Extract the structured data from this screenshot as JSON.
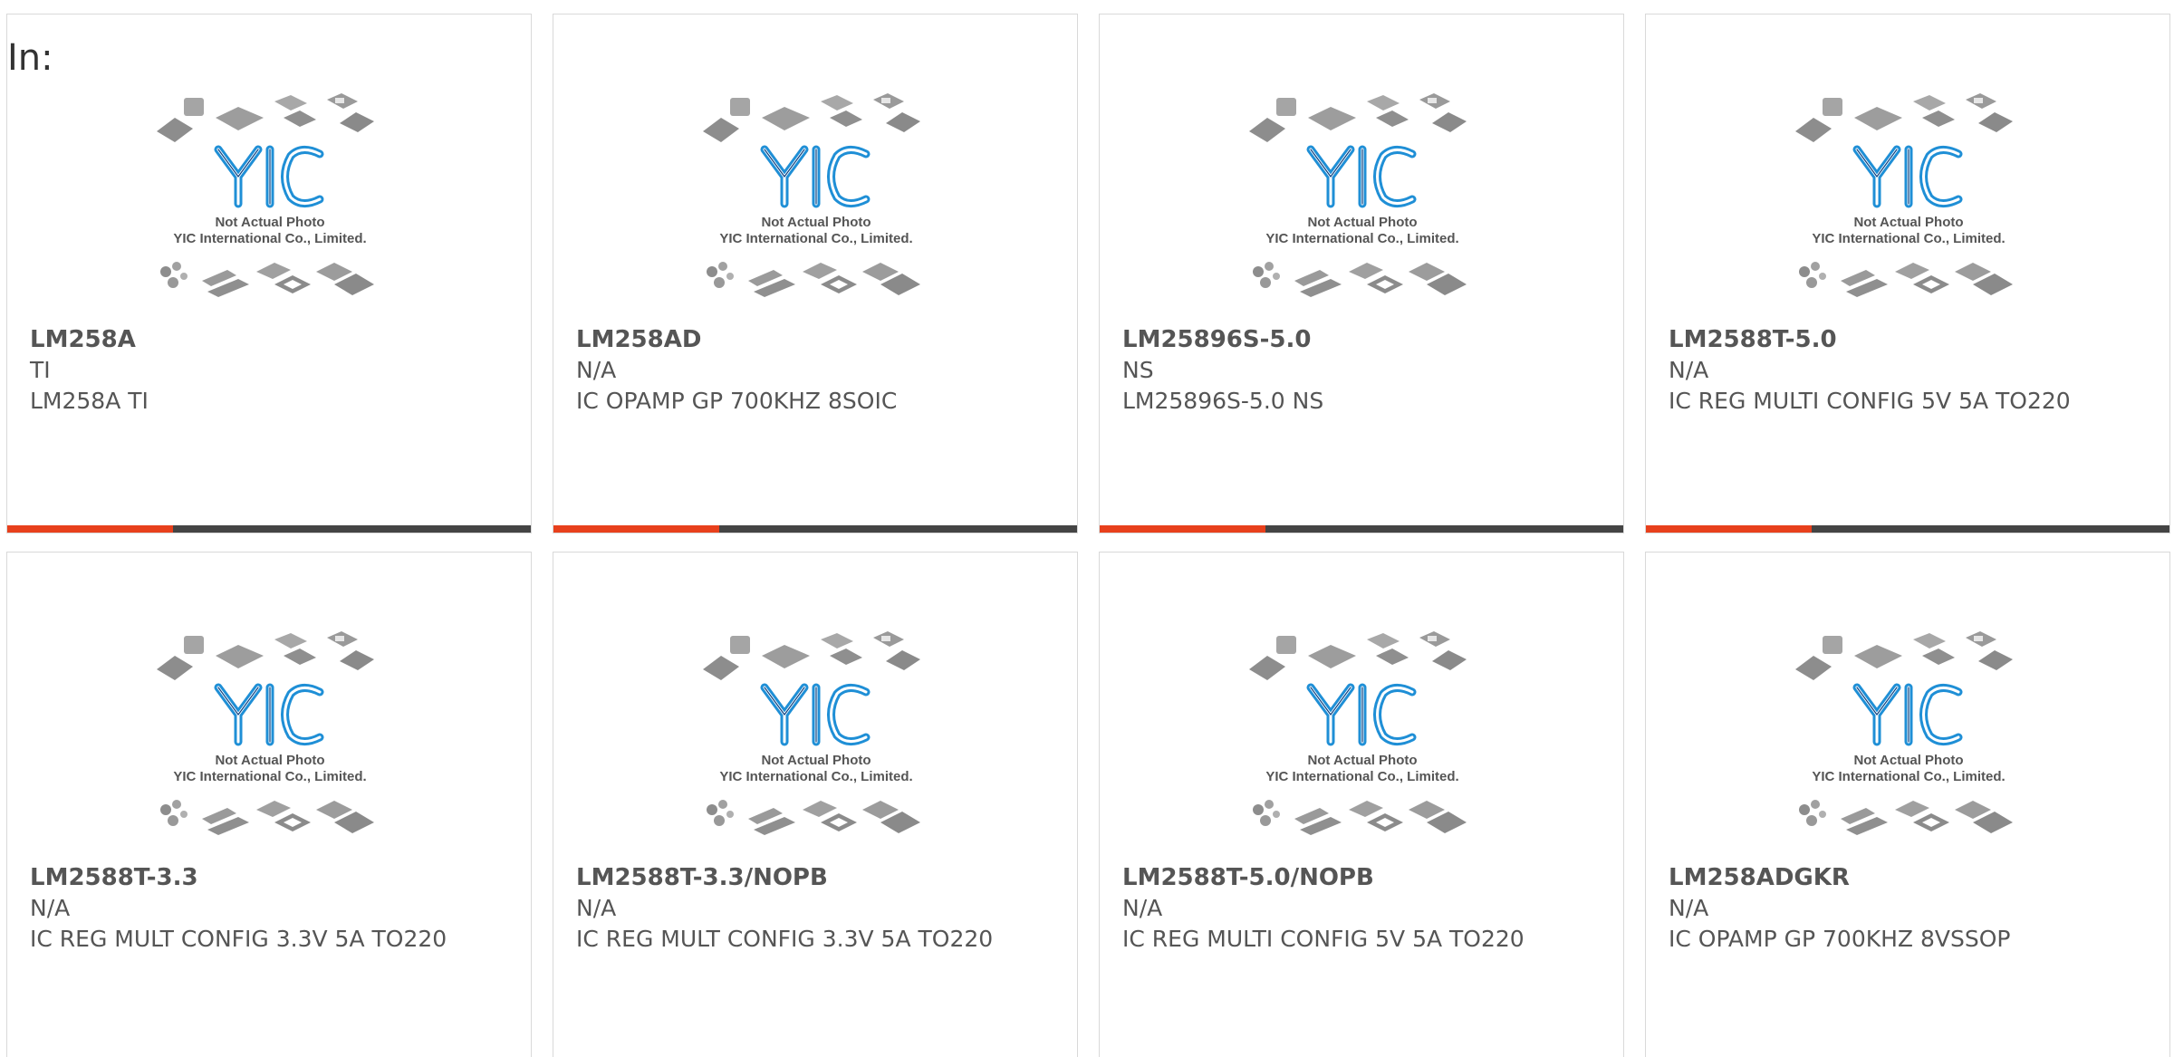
{
  "heading": "In:",
  "thumbnail": {
    "logo_text": "YIC",
    "caption_line1": "Not Actual Photo",
    "caption_line2": "YIC International Co., Limited."
  },
  "colors": {
    "accent": "#e8401c",
    "bar": "#444444",
    "logo_blue": "#1f8fd6"
  },
  "products": [
    {
      "part": "LM258A",
      "manufacturer": "TI",
      "description": "LM258A TI",
      "bar": true
    },
    {
      "part": "LM258AD",
      "manufacturer": "N/A",
      "description": "IC OPAMP GP 700KHZ 8SOIC",
      "bar": true
    },
    {
      "part": "LM25896S-5.0",
      "manufacturer": "NS",
      "description": "LM25896S-5.0 NS",
      "bar": true
    },
    {
      "part": "LM2588T-5.0",
      "manufacturer": "N/A",
      "description": "IC REG MULTI CONFIG 5V 5A TO220",
      "bar": true
    },
    {
      "part": "LM2588T-3.3",
      "manufacturer": "N/A",
      "description": "IC REG MULT CONFIG 3.3V 5A TO220",
      "bar": false
    },
    {
      "part": "LM2588T-3.3/NOPB",
      "manufacturer": "N/A",
      "description": "IC REG MULT CONFIG 3.3V 5A TO220",
      "bar": false
    },
    {
      "part": "LM2588T-5.0/NOPB",
      "manufacturer": "N/A",
      "description": "IC REG MULTI CONFIG 5V 5A TO220",
      "bar": false
    },
    {
      "part": "LM258ADGKR",
      "manufacturer": "N/A",
      "description": "IC OPAMP GP 700KHZ 8VSSOP",
      "bar": false
    }
  ]
}
